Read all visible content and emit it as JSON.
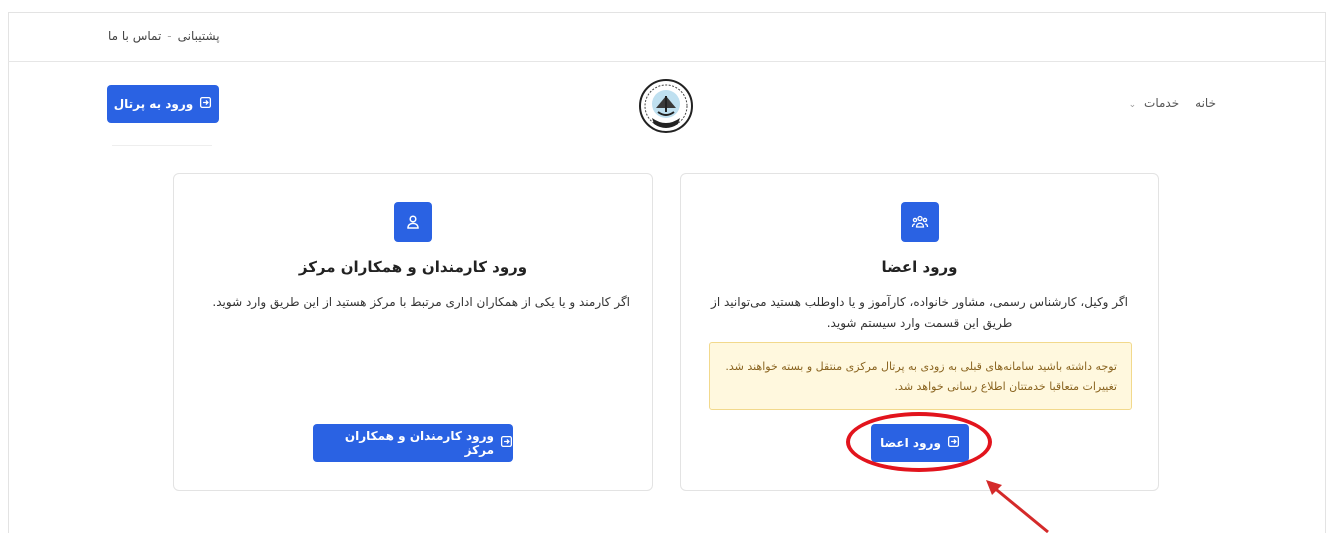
{
  "topbar": {
    "support_label": "پشتیبانی",
    "contact_label": "تماس با ما",
    "separator": "-"
  },
  "header": {
    "portal_button_label": "ورود به پرتال",
    "nav": {
      "home_label": "خانه",
      "services_label": "خدمات"
    }
  },
  "cards": {
    "members": {
      "title": "ورود اعضا",
      "description": "اگر وکیل، کارشناس رسمی، مشاور خانواده، کارآموز و یا داوطلب هستید می‌توانید از طریق این قسمت وارد سیستم شوید.",
      "notice": "توجه داشته باشید سامانه‌های قبلی به زودی به پرتال مرکزی منتقل و بسته خواهند شد. تغییرات متعاقبا خدمتتان اطلاع رسانی خواهد شد.",
      "button_label": "ورود اعضا",
      "icon": "users-group-icon"
    },
    "staff": {
      "title": "ورود کارمندان و همکاران مرکز",
      "description": "اگر کارمند و یا یکی از همکاران اداری مرتبط با مرکز هستید از این طریق وارد شوید.",
      "button_label": "ورود کارمندان و همکاران مرکز",
      "icon": "user-icon"
    }
  },
  "colors": {
    "primary": "#2a62e3",
    "notice_bg": "#fff8de",
    "notice_text": "#8a6420",
    "highlight": "#e2141d"
  }
}
